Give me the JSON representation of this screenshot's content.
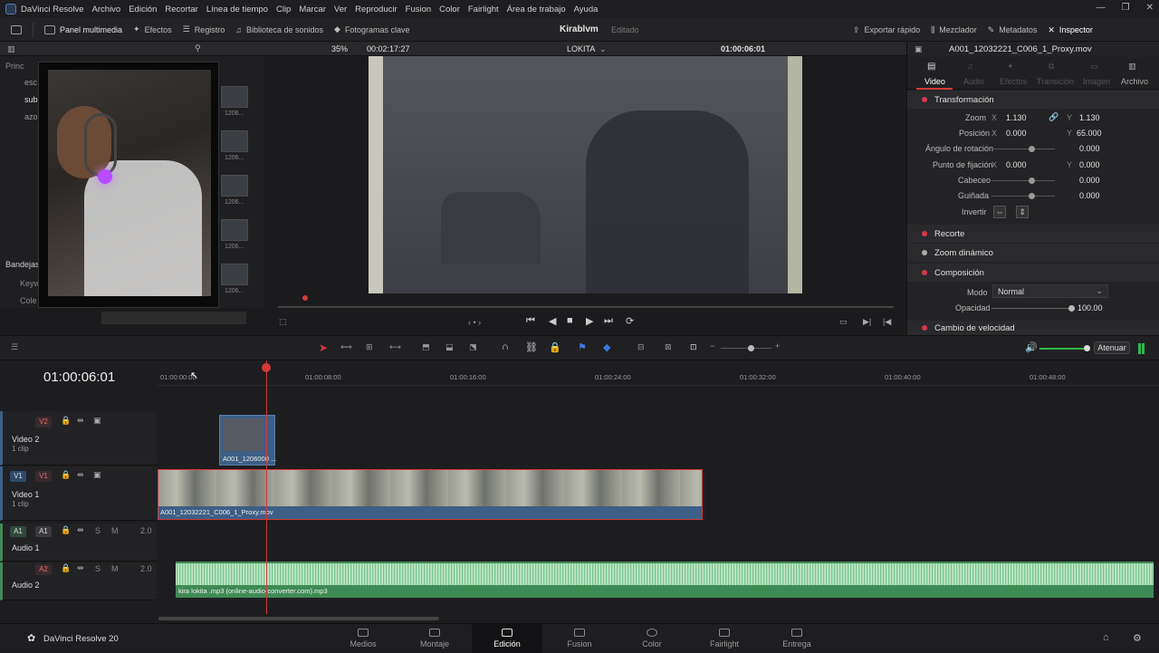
{
  "app": {
    "name": "DaVinci Resolve"
  },
  "menu": [
    "Archivo",
    "Edición",
    "Recortar",
    "Línea de tiempo",
    "Clip",
    "Marcar",
    "Ver",
    "Reproducir",
    "Fusion",
    "Color",
    "Fairlight",
    "Área de trabajo",
    "Ayuda"
  ],
  "toolbar": {
    "media_panel": "Panel multimedia",
    "effects": "Efectos",
    "index": "Registro",
    "sound_library": "Biblioteca de sonidos",
    "keyframes": "Fotogramas clave",
    "project_title": "Kirablvm",
    "project_state": "Editado",
    "quick_export": "Exportar rápido",
    "mixer": "Mezclador",
    "metadata": "Metadatos",
    "inspector": "Inspector"
  },
  "media": {
    "root": "Princ",
    "bins": [
      "esc",
      "sub",
      "azo"
    ],
    "smart_bins": "Bandejas",
    "smart_items": [
      "Keyw",
      "Cole"
    ],
    "thumb_labels": [
      "1206...",
      "1206...",
      "1206...",
      "1206...",
      "1206..."
    ]
  },
  "viewer": {
    "zoom": "35%",
    "duration": "00:02:17:27",
    "timeline_name": "LOKITA",
    "timecode": "01:00:06:01"
  },
  "inspector": {
    "clip_name": "A001_12032221_C006_1_Proxy.mov",
    "tabs": [
      "Video",
      "Audio",
      "Efectos",
      "Transición",
      "Imagen",
      "Archivo"
    ],
    "sections": {
      "transform": "Transformación",
      "crop": "Recorte",
      "dynamic_zoom": "Zoom dinámico",
      "composite": "Composición",
      "speed_change": "Cambio de velocidad"
    },
    "fields": {
      "zoom_label": "Zoom",
      "zoom_x": "1.130",
      "zoom_y": "1.130",
      "position_label": "Posición",
      "pos_x": "0.000",
      "pos_y": "65.000",
      "rotation_label": "Ángulo de rotación",
      "rotation": "0.000",
      "anchor_label": "Punto de fijación",
      "anchor_x": "0.000",
      "anchor_y": "0.000",
      "pitch_label": "Cabeceo",
      "pitch": "0.000",
      "yaw_label": "Guiñada",
      "yaw": "0.000",
      "flip_label": "Invertir",
      "mode_label": "Modo",
      "mode": "Normal",
      "opacity_label": "Opacidad",
      "opacity": "100.00",
      "x": "X",
      "y": "Y"
    }
  },
  "timeline": {
    "timecode": "01:00:06:01",
    "ruler": [
      "01:00:00:00",
      "01:00:08:00",
      "01:00:16:00",
      "01:00:24:00",
      "01:00:32:00",
      "01:00:40:00",
      "01:00:48:00"
    ],
    "tracks": {
      "v2": {
        "badge": "V2",
        "name": "Video 2",
        "count": "1 clip"
      },
      "v1": {
        "src": "V1",
        "badge": "V1",
        "name": "Video 1",
        "count": "1 clip"
      },
      "a1": {
        "src": "A1",
        "badge": "A1",
        "name": "Audio 1",
        "level": "2.0"
      },
      "a2": {
        "badge": "A2",
        "name": "Audio 2",
        "level": "2.0"
      }
    },
    "clips": {
      "v2": "A001_1206000 ...",
      "v1": "A001_12032221_C006_1_Proxy.mov",
      "a2": "kira lokita .mp3 (online-audio-converter.com).mp3"
    },
    "dim_button": "Atenuar",
    "solo": "S",
    "mute": "M"
  },
  "pages": {
    "brand": "DaVinci Resolve 20",
    "items": [
      "Medios",
      "Montaje",
      "Edición",
      "Fusion",
      "Color",
      "Fairlight",
      "Entrega"
    ],
    "active": "Edición"
  },
  "colors": {
    "accent_red": "#d33a3a",
    "clip_blue": "#3d5f86",
    "audio_green": "#3f8a55"
  }
}
